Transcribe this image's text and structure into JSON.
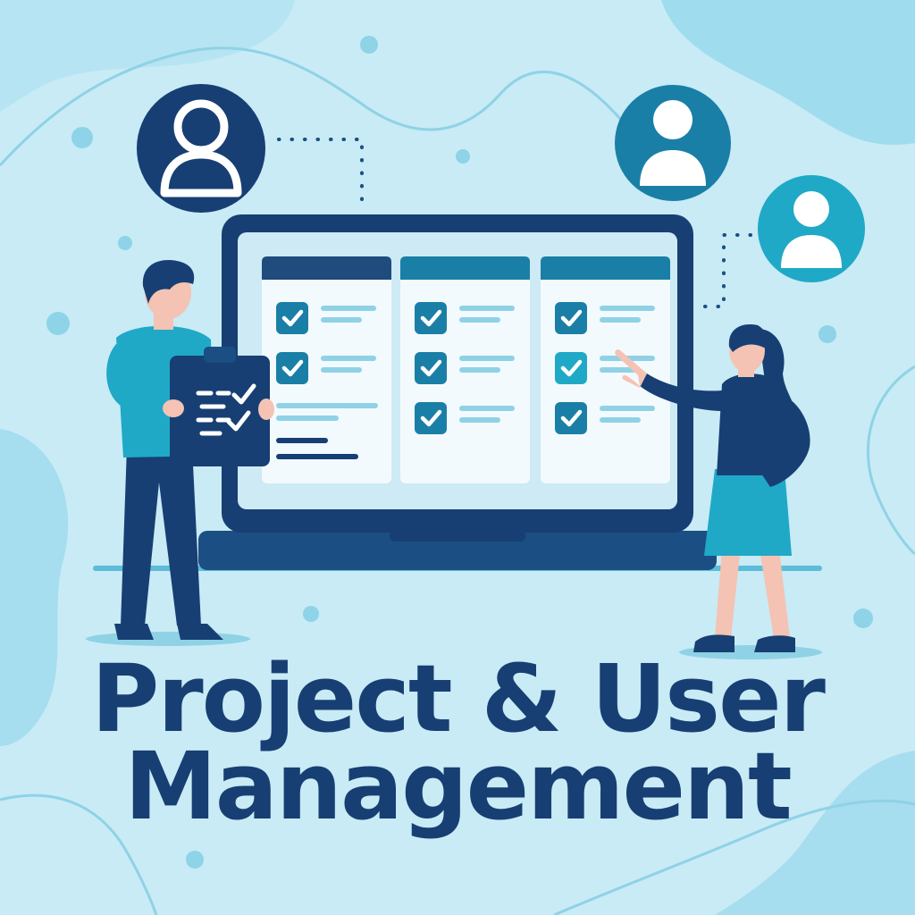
{
  "title": {
    "line1": "Project & User",
    "line2": "Management"
  },
  "colors": {
    "background": "#c8ebf5",
    "blob_light": "#a8dff0",
    "blob_mid": "#8fd4ea",
    "navy": "#173f73",
    "dark_blue": "#1b4f84",
    "teal": "#1a7fa6",
    "bright_teal": "#1fa9c7",
    "column_header_navy": "#1f4b7d",
    "card_white": "#f3fafd",
    "line_light": "#8fd2e6",
    "skin": "#f4c3b3",
    "title_text": "#173f73"
  },
  "icons": {
    "user_avatar": "user-avatar-icon",
    "checkbox": "checkbox-checked-icon",
    "clipboard": "clipboard-icon",
    "laptop": "laptop-icon"
  },
  "board": {
    "columns": [
      {
        "checked_items": 2
      },
      {
        "checked_items": 3
      },
      {
        "checked_items": 3
      }
    ]
  }
}
